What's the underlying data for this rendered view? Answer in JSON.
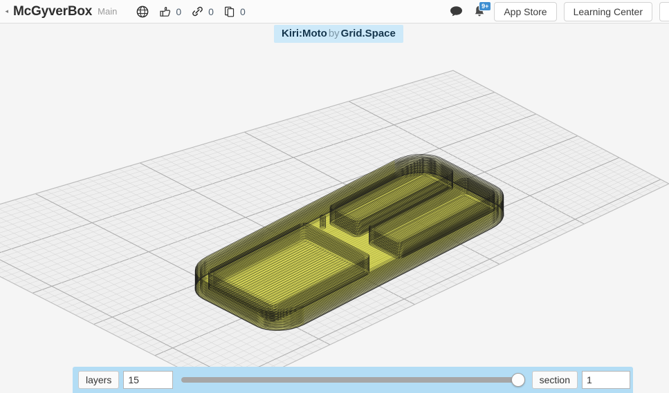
{
  "header": {
    "edge_stub": "◂",
    "app_title": "McGyverBox",
    "workspace": "Main",
    "stats": [
      {
        "icon": "globe-icon",
        "name": "visibility-globe",
        "count": ""
      },
      {
        "icon": "thumbs-up-icon",
        "name": "likes",
        "count": "0"
      },
      {
        "icon": "link-icon",
        "name": "links",
        "count": "0"
      },
      {
        "icon": "copy-icon",
        "name": "copies",
        "count": "0"
      }
    ],
    "chat_icon": "chat-bubble-icon",
    "bell_icon": "bell-icon",
    "bell_badge": "9+",
    "app_store_label": "App Store",
    "learning_center_label": "Learning Center"
  },
  "banner": {
    "product": "Kiri:Moto",
    "by": "by",
    "vendor": "Grid.Space",
    "bg_color": "#cde9f9"
  },
  "viewport": {
    "background_color": "#f5f5f5",
    "grid_minor_color": "#d8d8d8",
    "grid_major_color": "#a9a9a9",
    "model_fill_color": "#d6d63c",
    "model_line_color": "#181818",
    "model_name": "sliced-box-model"
  },
  "controls": {
    "bar_color": "#b3ddf5",
    "layers_label": "layers",
    "layers_value": "15",
    "section_label": "section",
    "section_value": "1",
    "slider": {
      "name": "layer-slider",
      "position_percent": 100,
      "min": "0",
      "max": "15"
    }
  }
}
